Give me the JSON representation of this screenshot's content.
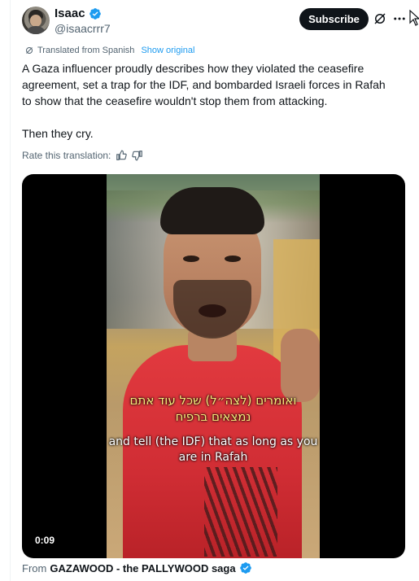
{
  "author": {
    "display_name": "Isaac",
    "handle": "@isaacrrr7",
    "verified": true,
    "avatar_icon": "avatar-photo"
  },
  "header_actions": {
    "subscribe_label": "Subscribe",
    "grok_icon": "grok-icon",
    "more_icon": "more-icon"
  },
  "translation": {
    "translated_label": "Translated from Spanish",
    "show_original_label": "Show original",
    "rate_label": "Rate this translation:",
    "thumbs_up_icon": "thumbs-up-icon",
    "thumbs_down_icon": "thumbs-down-icon"
  },
  "tweet": {
    "text_line_1": "A Gaza influencer proudly describes how they violated the ceasefire agreement, set a trap for the IDF, and bombarded Israeli forces in Rafah to show that the ceasefire wouldn't stop them from attacking.",
    "text_line_2": "Then they cry."
  },
  "media": {
    "subtitle_hebrew_1": "ואומרים (לצה״ל) שכל עוד אתם",
    "subtitle_hebrew_2": "נמצאים ברפיח",
    "subtitle_english_1": "and tell (the IDF) that as long as you",
    "subtitle_english_2": "are in Rafah",
    "duration": "0:09"
  },
  "attribution": {
    "from_label": "From",
    "source_name": "GAZAWOOD - the PALLYWOOD saga",
    "source_verified": true
  },
  "colors": {
    "accent": "#1d9bf0",
    "text_primary": "#0f1419",
    "text_secondary": "#536471"
  }
}
